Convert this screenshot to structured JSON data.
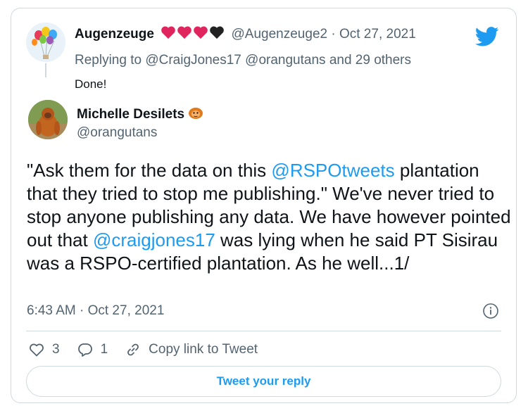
{
  "reply": {
    "name": "Augenzeuge",
    "hearts": [
      "red",
      "red",
      "red",
      "black"
    ],
    "handle": "@Augenzeuge2",
    "separator": "·",
    "date": "Oct 27, 2021",
    "replying_prefix": "Replying to",
    "replying_user1": "@CraigJones17",
    "replying_user2": "@orangutans",
    "replying_suffix": "and 29 others",
    "text": "Done!"
  },
  "tweet": {
    "author_name": "Michelle Desilets",
    "author_handle": "@orangutans",
    "body_part1": "\"Ask them for the data on this ",
    "mention1": "@RSPOtweets",
    "body_part2": " plantation that they tried to stop me publishing.\" We've never tried to stop anyone publishing any data. We have however pointed out that ",
    "mention2": "@craigjones17",
    "body_part3": " was lying when he said PT Sisirau was a RSPO-certified plantation. As he well...1/",
    "timestamp": "6:43 AM · Oct 27, 2021"
  },
  "actions": {
    "like_count": "3",
    "reply_count": "1",
    "copy_link_label": "Copy link to Tweet"
  },
  "reply_button_label": "Tweet your reply",
  "colors": {
    "accent": "#1d9bf0",
    "heart_red": "#e0245e",
    "text": "#0f1419",
    "secondary": "#536471"
  },
  "icons": [
    "balloons-avatar-icon",
    "twitter-bird-icon",
    "orangutan-avatar-icon",
    "orangutan-emoji-icon",
    "info-icon",
    "heart-icon",
    "reply-bubble-icon",
    "link-icon"
  ]
}
